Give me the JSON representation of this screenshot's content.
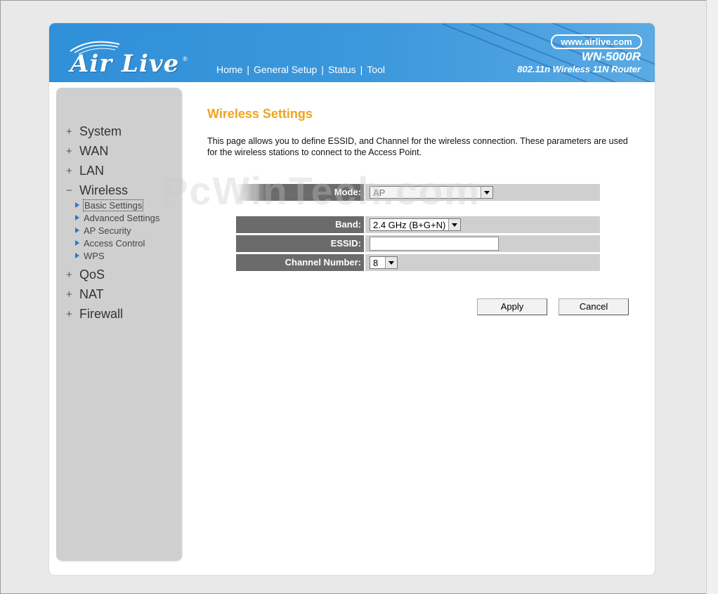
{
  "header": {
    "logo_text": "Air Live",
    "logo_reg": "®",
    "url": "www.airlive.com",
    "model": "WN-5000R",
    "model_sub": "802.11n Wireless 11N Router",
    "nav": [
      "Home",
      "General Setup",
      "Status",
      "Tool"
    ],
    "nav_sep": "|"
  },
  "sidebar": {
    "items": [
      {
        "sign": "+",
        "label": "System"
      },
      {
        "sign": "+",
        "label": "WAN"
      },
      {
        "sign": "+",
        "label": "LAN"
      },
      {
        "sign": "−",
        "label": "Wireless"
      },
      {
        "sign": "+",
        "label": "QoS"
      },
      {
        "sign": "+",
        "label": "NAT"
      },
      {
        "sign": "+",
        "label": "Firewall"
      }
    ],
    "wireless_sub": [
      "Basic Settings",
      "Advanced Settings",
      "AP Security",
      "Access Control",
      "WPS"
    ],
    "active_sub": "Basic Settings"
  },
  "main": {
    "title": "Wireless Settings",
    "description": "This page allows you to define ESSID, and Channel for the wireless connection. These parameters are used for the wireless stations to connect to the Access Point.",
    "watermark": "PcWinTech.com",
    "mode": {
      "label": "Mode:",
      "value": "AP"
    },
    "band": {
      "label": "Band:",
      "value": "2.4 GHz (B+G+N)"
    },
    "essid": {
      "label": "ESSID:",
      "value": ""
    },
    "channel": {
      "label": "Channel Number:",
      "value": "8"
    },
    "apply_label": "Apply",
    "cancel_label": "Cancel"
  },
  "colors": {
    "header_blue": "#3d98dc",
    "title_orange": "#f0a31c",
    "label_gray": "#6b6b6b",
    "value_gray": "#cfcfcf"
  }
}
